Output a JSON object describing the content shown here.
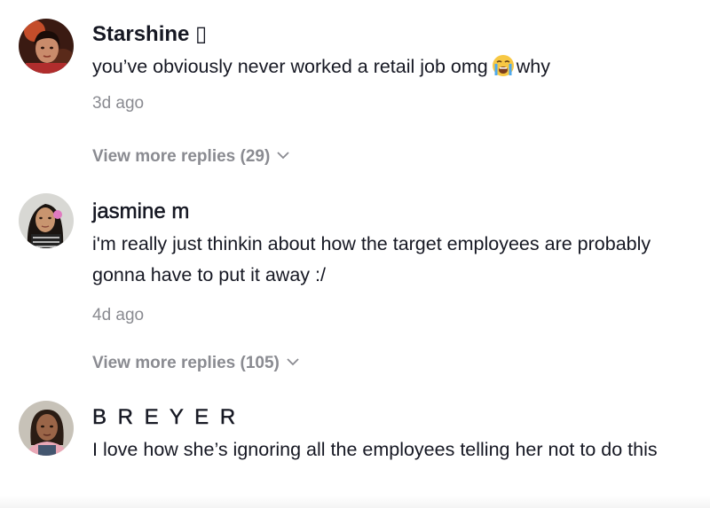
{
  "comments": [
    {
      "username": "Starshine ▯",
      "text_before_emoji": "you’ve obviously never worked a retail job omg",
      "emoji": "loudly-crying-face-emoji",
      "text_after_emoji": "why",
      "time": "3d ago",
      "replies_label": "View more replies (29)"
    },
    {
      "username": "jasmine m",
      "text": "i'm really just thinkin about how the target employees are probably gonna have to put it away :/",
      "time": "4d ago",
      "replies_label": "View more replies (105)"
    },
    {
      "username": "B R E Y E R",
      "text": "I love how she’s ignoring all the employees telling her not to do this"
    }
  ],
  "colors": {
    "primary_text": "#161823",
    "secondary_text": "#8a8b91"
  }
}
